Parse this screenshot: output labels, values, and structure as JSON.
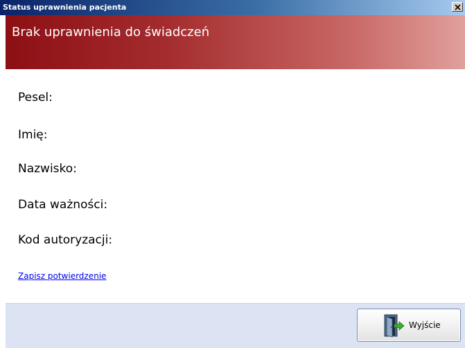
{
  "window": {
    "title": "Status uprawnienia pacjenta",
    "close_glyph": "✕"
  },
  "header": {
    "message": "Brak uprawnienia do świadczeń"
  },
  "fields": [
    {
      "label": "Pesel:"
    },
    {
      "label": "Imię:"
    },
    {
      "label": "Nazwisko:"
    },
    {
      "label": "Data ważności:"
    },
    {
      "label": "Kod autoryzacji:"
    }
  ],
  "links": {
    "save_confirmation": "Zapisz potwierdzenie"
  },
  "footer": {
    "exit_label": "Wyjście",
    "exit_icon": "exit-door-icon"
  },
  "colors": {
    "titlebar_start": "#0a246a",
    "titlebar_end": "#a6caf0",
    "banner_start": "#8c0f14",
    "banner_end": "#e0a09c",
    "footer_bg": "#dce4f4",
    "link": "#0000ee"
  }
}
